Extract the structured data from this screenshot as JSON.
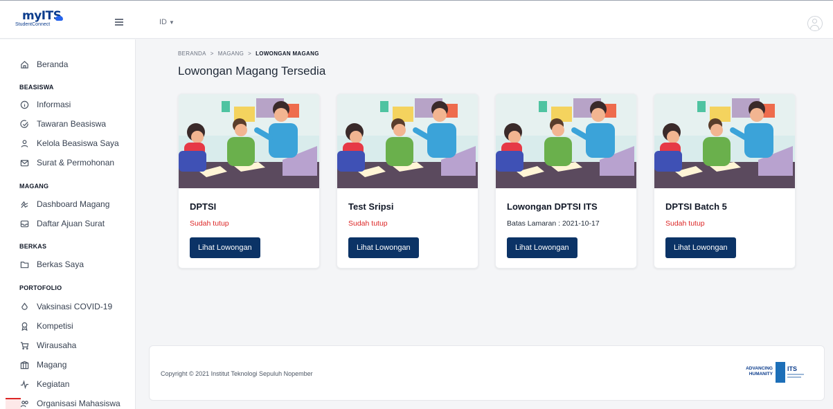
{
  "header": {
    "logo_text": "myITS",
    "logo_sub": "StudentConnect",
    "language": "ID"
  },
  "sidebar": {
    "home": "Beranda",
    "sections": [
      {
        "title": "BEASISWA",
        "items": [
          "Informasi",
          "Tawaran Beasiswa",
          "Kelola Beasiswa Saya",
          "Surat & Permohonan"
        ]
      },
      {
        "title": "MAGANG",
        "items": [
          "Dashboard Magang",
          "Daftar Ajuan Surat"
        ]
      },
      {
        "title": "BERKAS",
        "items": [
          "Berkas Saya"
        ]
      },
      {
        "title": "PORTOFOLIO",
        "items": [
          "Vaksinasi COVID-19",
          "Kompetisi",
          "Wirausaha",
          "Magang",
          "Kegiatan",
          "Organisasi Mahasiswa"
        ]
      }
    ]
  },
  "breadcrumb": {
    "items": [
      "BERANDA",
      "MAGANG",
      "LOWONGAN MAGANG"
    ],
    "separator": ">"
  },
  "page": {
    "title": "Lowongan Magang Tersedia"
  },
  "cards": [
    {
      "title": "DPTSI",
      "status": "Sudah tutup",
      "button": "Lihat Lowongan"
    },
    {
      "title": "Test Sripsi",
      "status": "Sudah tutup",
      "button": "Lihat Lowongan"
    },
    {
      "title": "Lowongan DPTSI ITS",
      "status": "Batas Lamaran : 2021-10-17",
      "button": "Lihat Lowongan"
    },
    {
      "title": "DPTSI Batch 5",
      "status": "Sudah tutup",
      "button": "Lihat Lowongan"
    }
  ],
  "footer": {
    "copyright": "Copyright © 2021 Institut Teknologi Sepuluh Nopember",
    "logo_line1": "ADVANCING",
    "logo_line2": "HUMANITY",
    "logo_its": "ITS"
  },
  "colors": {
    "primary_button": "#0b3366",
    "status_closed": "#dc2626",
    "brand": "#0b3c8c"
  }
}
